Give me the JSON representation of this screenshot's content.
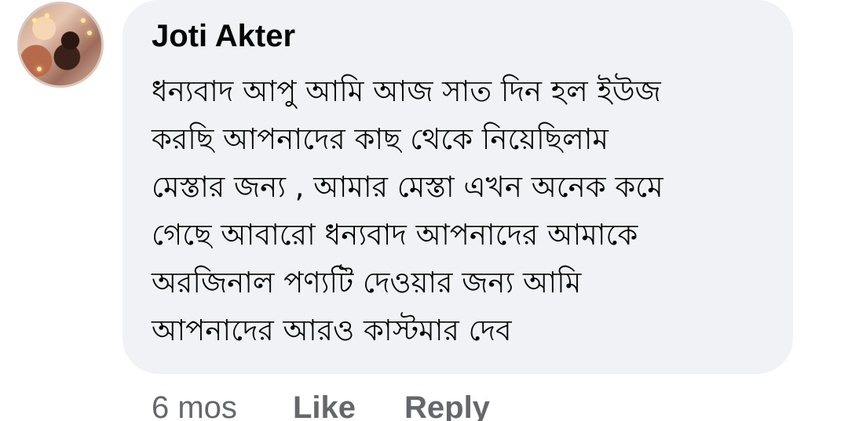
{
  "comment": {
    "author": "Joti Akter",
    "avatar_icon": "profile-photo-avatar",
    "message_lines": [
      "ধন্যবাদ আপু আমি আজ সাত দিন হল ইউজ",
      "করছি আপনাদের কাছ থেকে নিয়েছিলাম",
      "মেস্তার জন্য , আমার মেস্তা এখন অনেক কমে",
      "গেছে আবারো ধন্যবাদ আপনাদের আমাকে",
      "অরজিনাল পণ্যটি দেওয়ার জন্য আমি",
      "আপনাদের আরও কাস্টমার দেব"
    ],
    "time": "6 mos",
    "like_label": "Like",
    "reply_label": "Reply"
  },
  "colors": {
    "bubble": "#f0f2f5",
    "author_text": "#050505",
    "meta_text": "#65676b"
  }
}
